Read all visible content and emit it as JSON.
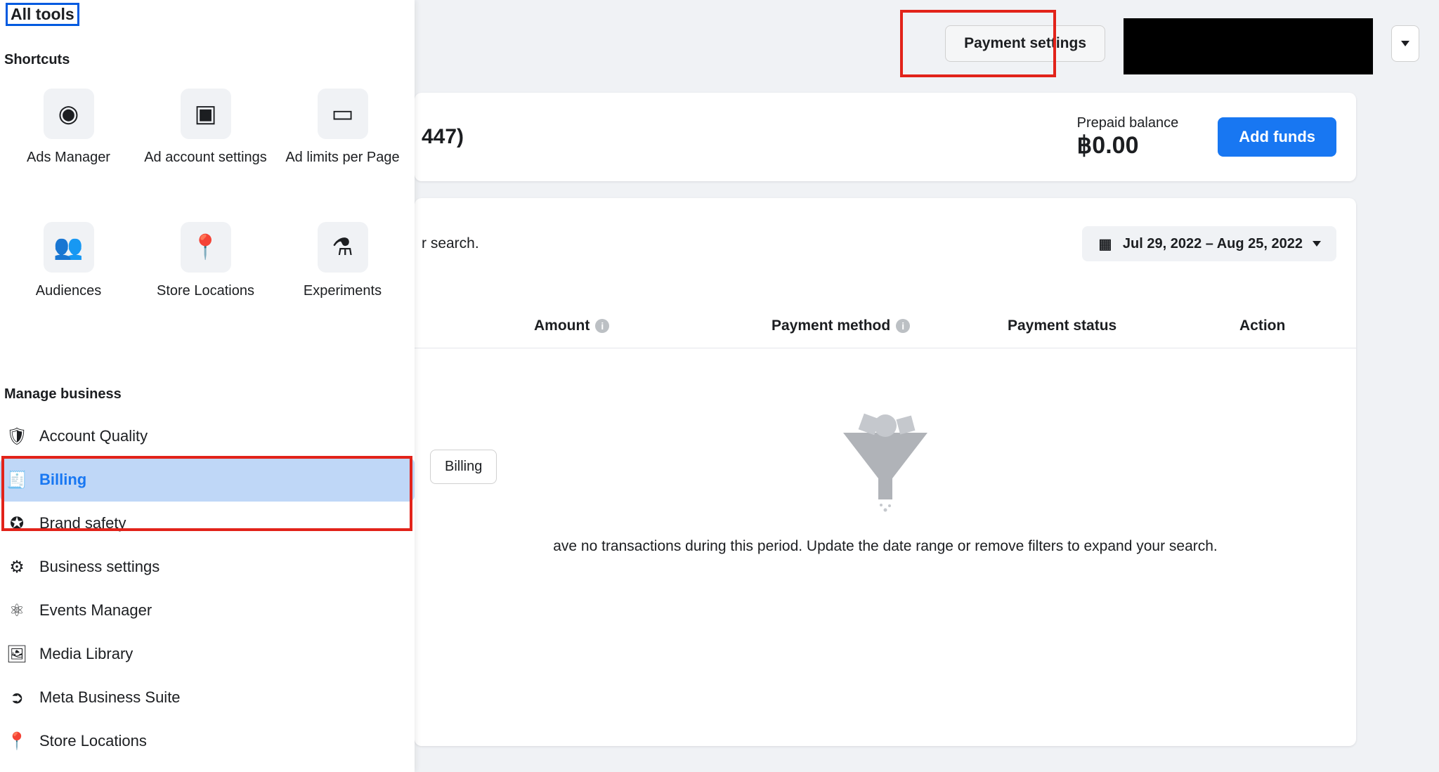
{
  "sidebar": {
    "all_tools": "All tools",
    "section_shortcuts": "Shortcuts",
    "section_manage": "Manage business",
    "shortcuts": [
      {
        "label": "Ads Manager",
        "icon_name": "compass-icon",
        "glyph": "◉"
      },
      {
        "label": "Ad account settings",
        "icon_name": "settings-card-icon",
        "glyph": "▣"
      },
      {
        "label": "Ad limits per Page",
        "icon_name": "device-icon",
        "glyph": "▭"
      },
      {
        "label": "Audiences",
        "icon_name": "people-icon",
        "glyph": "👥"
      },
      {
        "label": "Store Locations",
        "icon_name": "pin-icon",
        "glyph": "📍"
      },
      {
        "label": "Experiments",
        "icon_name": "flask-icon",
        "glyph": "⚗"
      }
    ],
    "manage": [
      {
        "label": "Account Quality",
        "icon_name": "shield-icon",
        "glyph": "🛡"
      },
      {
        "label": "Billing",
        "icon_name": "billing-icon",
        "glyph": "🧾",
        "selected": true
      },
      {
        "label": "Brand safety",
        "icon_name": "badge-icon",
        "glyph": "✪"
      },
      {
        "label": "Business settings",
        "icon_name": "gear-icon",
        "glyph": "⚙"
      },
      {
        "label": "Events Manager",
        "icon_name": "nodes-icon",
        "glyph": "⚛"
      },
      {
        "label": "Media Library",
        "icon_name": "image-icon",
        "glyph": "🖼"
      },
      {
        "label": "Meta Business Suite",
        "icon_name": "arrow-right-circle-icon",
        "glyph": "➲"
      },
      {
        "label": "Store Locations",
        "icon_name": "pin-icon",
        "glyph": "📍"
      }
    ]
  },
  "topbar": {
    "payment_settings": "Payment settings"
  },
  "account_card": {
    "account_suffix": "447)",
    "prepaid_label": "Prepaid balance",
    "prepaid_amount": "฿0.00",
    "add_funds": "Add funds"
  },
  "filters": {
    "search_suffix": "r search.",
    "date_range": "Jul 29, 2022 – Aug 25, 2022"
  },
  "table_headers": {
    "amount": "Amount",
    "payment_method": "Payment method",
    "payment_status": "Payment status",
    "action": "Action"
  },
  "tooltip": {
    "billing": "Billing"
  },
  "empty_state": {
    "message": "ave no transactions during this period. Update the date range or remove filters to expand your search."
  }
}
